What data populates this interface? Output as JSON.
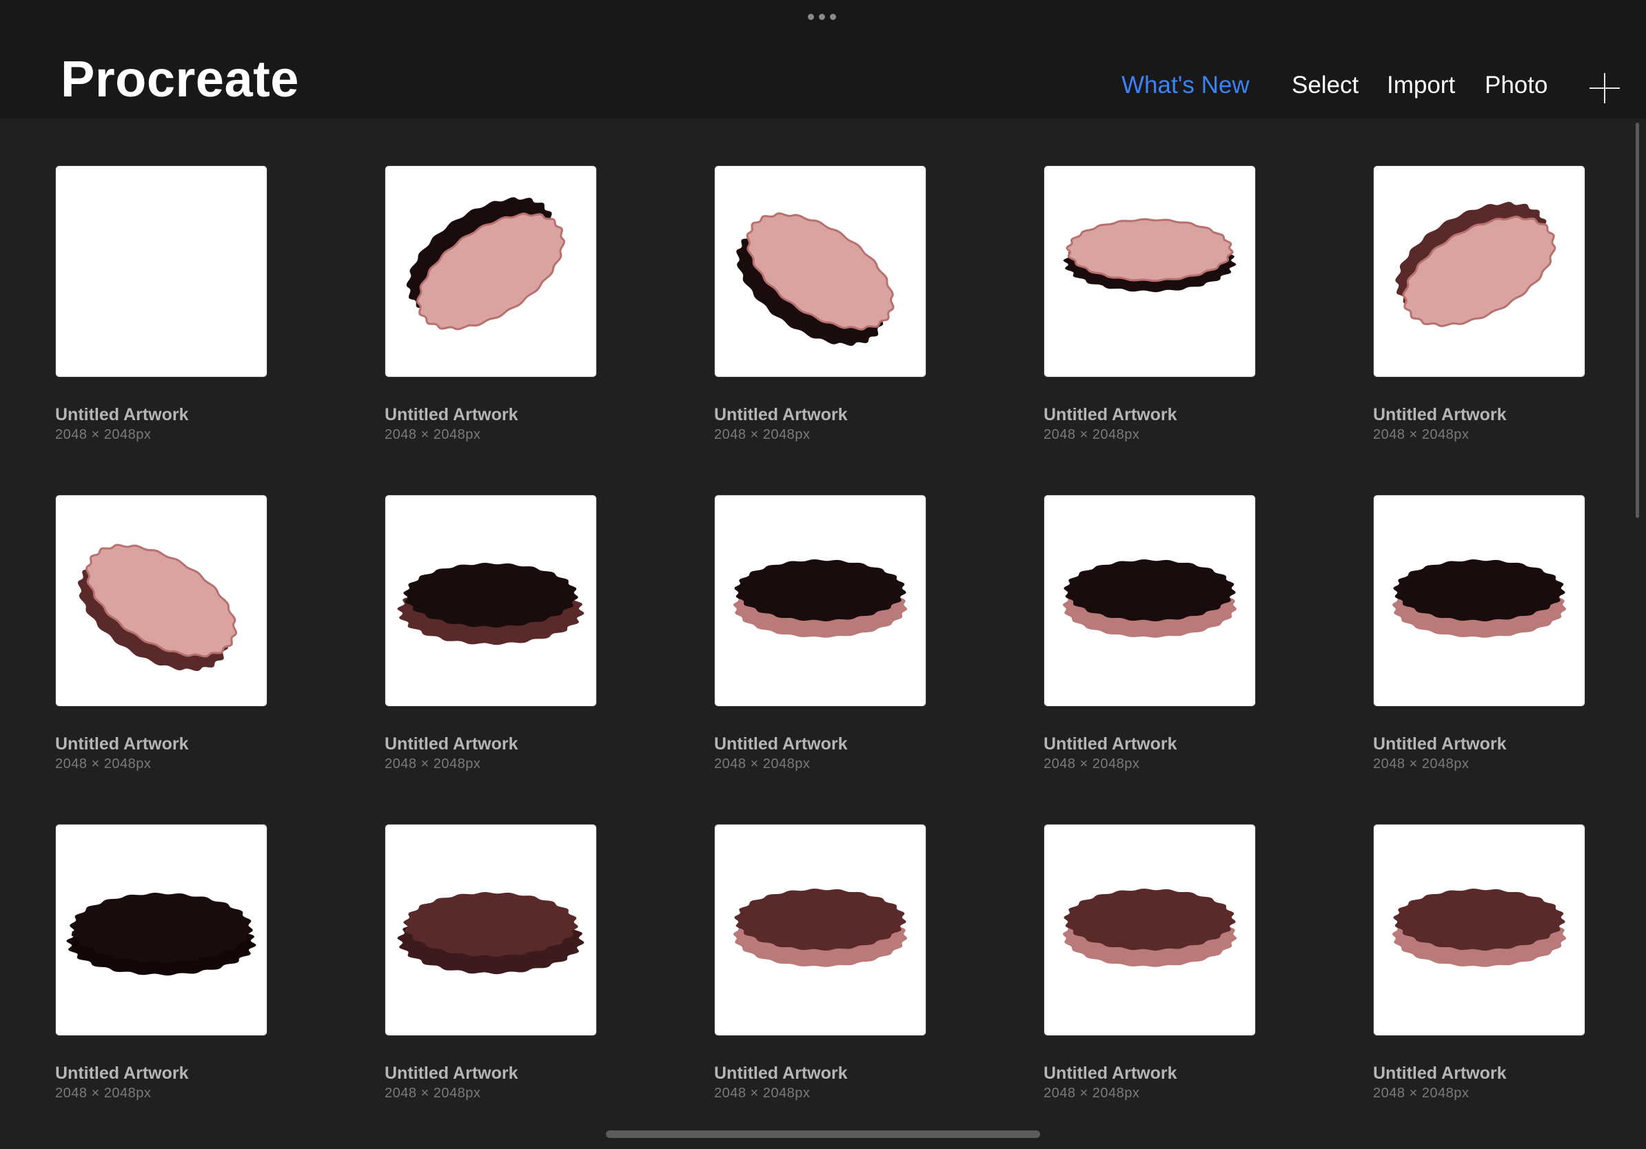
{
  "header": {
    "title": "Procreate",
    "whats_new": "What's New",
    "select": "Select",
    "import": "Import",
    "photo": "Photo",
    "accent_color": "#3b82f6"
  },
  "icons": {
    "more": "more-dots-icon",
    "new": "plus-icon"
  },
  "artworks": [
    {
      "title": "Untitled Artwork",
      "size": "2048 × 2048px",
      "thumb": "blank"
    },
    {
      "title": "Untitled Artwork",
      "size": "2048 × 2048px",
      "thumb": "tilt-up-dark-side"
    },
    {
      "title": "Untitled Artwork",
      "size": "2048 × 2048px",
      "thumb": "tilt-down-dark-side"
    },
    {
      "title": "Untitled Artwork",
      "size": "2048 × 2048px",
      "thumb": "flat-dark-band"
    },
    {
      "title": "Untitled Artwork",
      "size": "2048 × 2048px",
      "thumb": "tilt-up-brown-side"
    },
    {
      "title": "Untitled Artwork",
      "size": "2048 × 2048px",
      "thumb": "tilt-down-brown-side"
    },
    {
      "title": "Untitled Artwork",
      "size": "2048 × 2048px",
      "thumb": "dark-top-brown-base"
    },
    {
      "title": "Untitled Artwork",
      "size": "2048 × 2048px",
      "thumb": "dark-top-pink-base"
    },
    {
      "title": "Untitled Artwork",
      "size": "2048 × 2048px",
      "thumb": "dark-top-pink-base"
    },
    {
      "title": "Untitled Artwork",
      "size": "2048 × 2048px",
      "thumb": "dark-top-pink-base"
    },
    {
      "title": "Untitled Artwork",
      "size": "2048 × 2048px",
      "thumb": "all-dark"
    },
    {
      "title": "Untitled Artwork",
      "size": "2048 × 2048px",
      "thumb": "brown-layered"
    },
    {
      "title": "Untitled Artwork",
      "size": "2048 × 2048px",
      "thumb": "brown-top-pink-base"
    },
    {
      "title": "Untitled Artwork",
      "size": "2048 × 2048px",
      "thumb": "brown-top-pink-base"
    },
    {
      "title": "Untitled Artwork",
      "size": "2048 × 2048px",
      "thumb": "brown-top-pink-base"
    }
  ],
  "colors": {
    "background": "#202020",
    "topbar": "#181818",
    "pink": "#d9a3a1",
    "pink_edge": "#b8716f",
    "dark": "#1a0b0c",
    "brown": "#5a2a2a",
    "mauve": "#b97a79"
  }
}
